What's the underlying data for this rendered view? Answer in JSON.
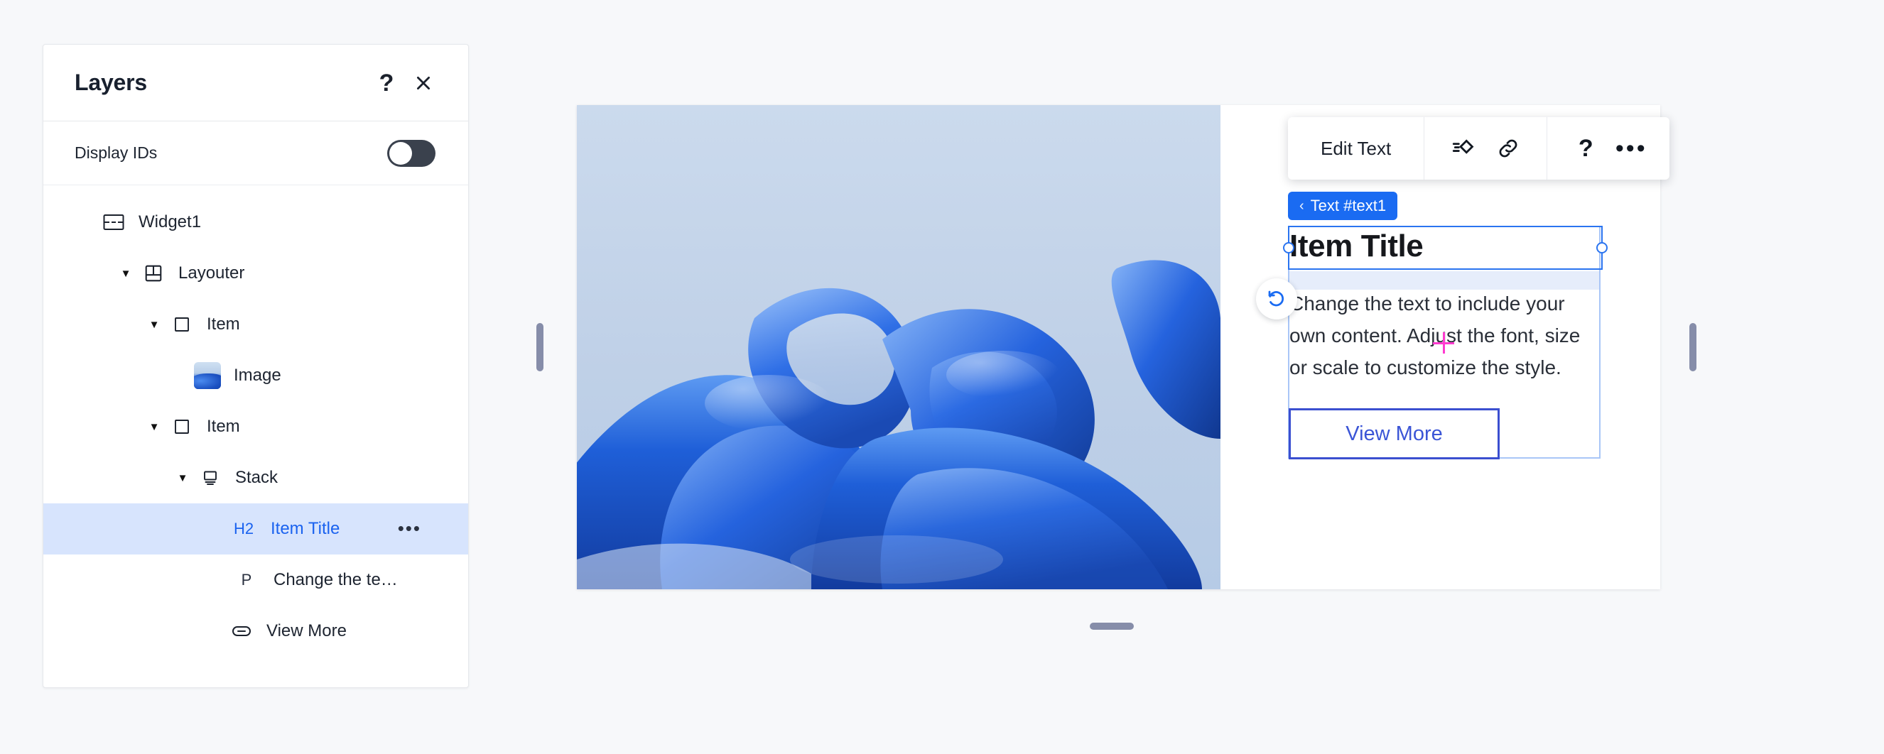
{
  "panel": {
    "title": "Layers",
    "help_icon": "question-mark-icon",
    "close_icon": "close-icon",
    "display_ids": {
      "label": "Display IDs",
      "enabled": false
    },
    "tree": [
      {
        "label": "Widget1",
        "icon": "widget-icon",
        "depth": 0,
        "caret": "",
        "selected": false,
        "tag": ""
      },
      {
        "label": "Layouter",
        "icon": "layout-icon",
        "depth": 1,
        "caret": "▼",
        "selected": false,
        "tag": ""
      },
      {
        "label": "Item",
        "icon": "square-icon",
        "depth": 2,
        "caret": "▼",
        "selected": false,
        "tag": ""
      },
      {
        "label": "Image",
        "icon": "image-thumbnail",
        "depth": 3,
        "caret": "",
        "selected": false,
        "tag": ""
      },
      {
        "label": "Item",
        "icon": "square-icon",
        "depth": 2,
        "caret": "▼",
        "selected": false,
        "tag": ""
      },
      {
        "label": "Stack",
        "icon": "stack-icon",
        "depth": 3,
        "caret": "▼",
        "selected": false,
        "tag": ""
      },
      {
        "label": "Item Title",
        "icon": "tag-label",
        "depth": 4,
        "caret": "",
        "selected": true,
        "tag": "H2",
        "more": "•••"
      },
      {
        "label": "Change the te…",
        "icon": "tag-label",
        "depth": 4,
        "caret": "",
        "selected": false,
        "tag": "P"
      },
      {
        "label": "View More",
        "icon": "button-icon",
        "depth": 4,
        "caret": "",
        "selected": false,
        "tag": ""
      }
    ]
  },
  "toolbar": {
    "edit_text_label": "Edit Text",
    "animation_icon": "animation-diamond-icon",
    "link_icon": "link-icon",
    "help_icon": "question-mark-icon",
    "more_icon": "ellipsis-icon",
    "more_glyph": "•••"
  },
  "selection": {
    "badge_label": "Text #text1",
    "badge_chevron": "‹",
    "badge_color": "#1a6bf2",
    "outline_color": "#2a74f0",
    "parent_outline_color": "#a9c6f7"
  },
  "card": {
    "title": "Item Title",
    "body": "Change the text to include your own content. Adjust the font, size or scale to customize the style.",
    "button_label": "View More",
    "button_color": "#3b55d6"
  },
  "canvas": {
    "undo_icon": "undo-icon",
    "image_alt": "blue-abstract-blob-image",
    "handle_left": "resize-handle-left",
    "handle_right": "resize-handle-right",
    "handle_bottom": "resize-handle-bottom"
  }
}
